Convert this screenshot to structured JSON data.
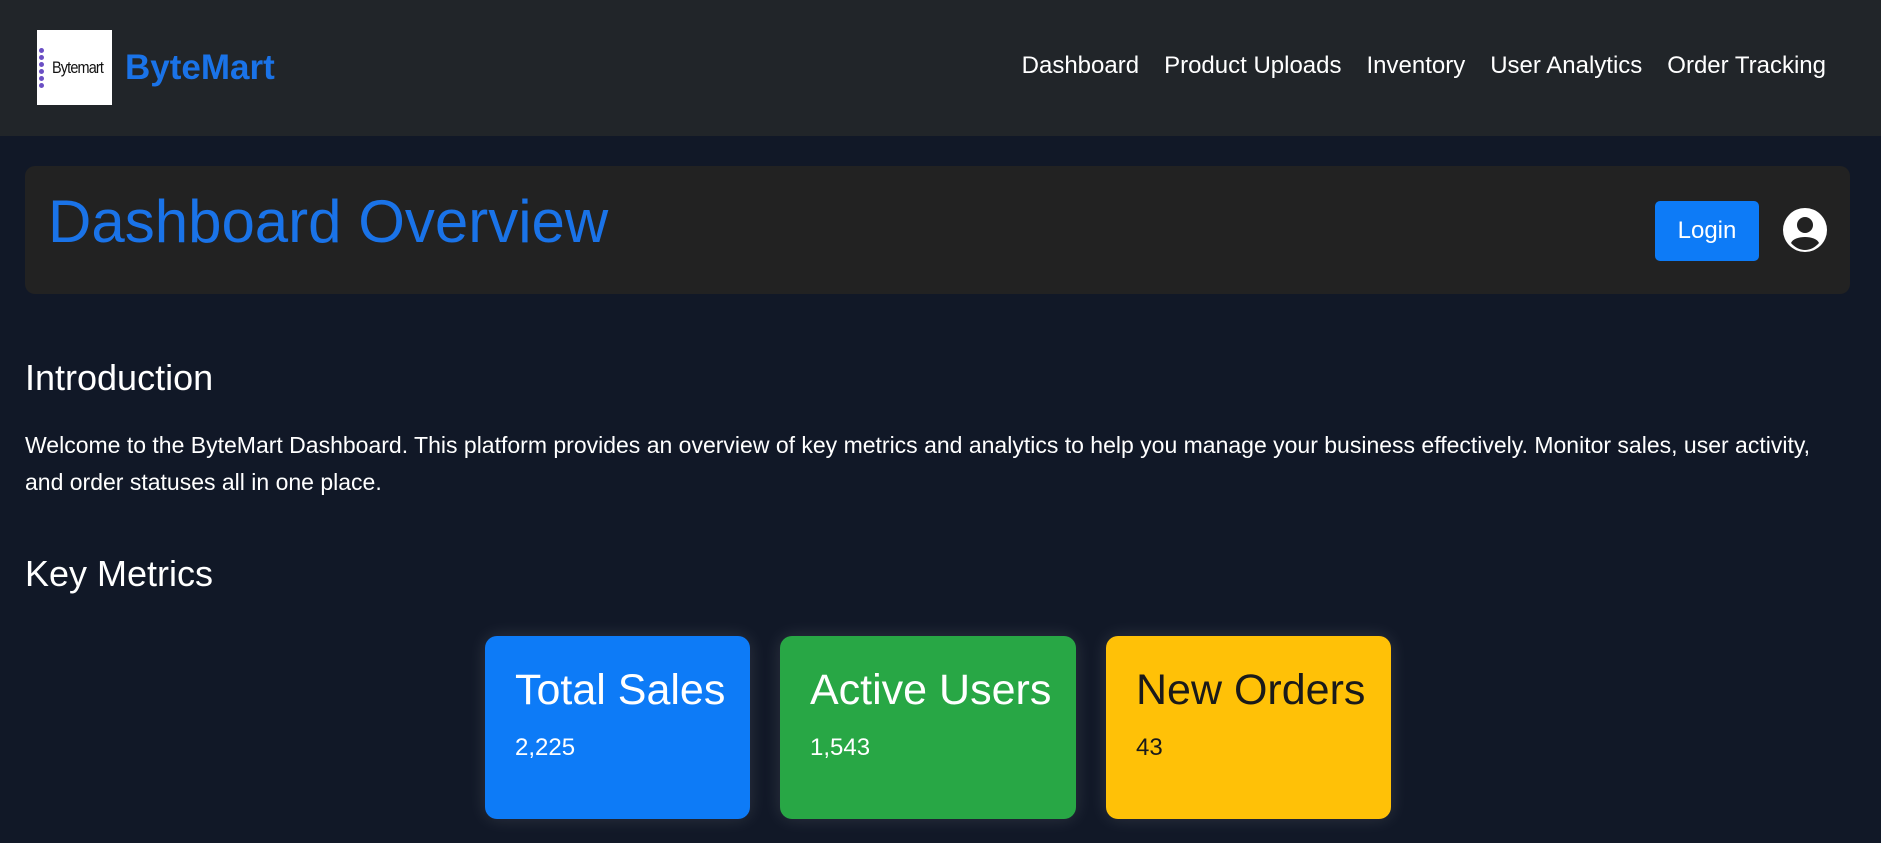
{
  "header": {
    "logo_text": "Bytemart",
    "brand_name": "ByteMart",
    "nav": [
      "Dashboard",
      "Product Uploads",
      "Inventory",
      "User Analytics",
      "Order Tracking"
    ]
  },
  "hero": {
    "title": "Dashboard Overview",
    "login_label": "Login",
    "user_icon": "user-circle-icon"
  },
  "intro": {
    "heading": "Introduction",
    "text": "Welcome to the ByteMart Dashboard. This platform provides an overview of key metrics and analytics to help you manage your business effectively. Monitor sales, user activity, and order statuses all in one place."
  },
  "metrics": {
    "heading": "Key Metrics",
    "cards": [
      {
        "title": "Total Sales",
        "value": "2,225",
        "color": "#0d7bf7"
      },
      {
        "title": "Active Users",
        "value": "1,543",
        "color": "#28a745"
      },
      {
        "title": "New Orders",
        "value": "43",
        "color": "#ffc107"
      }
    ]
  },
  "colors": {
    "brand": "#1a73e8",
    "navbar_bg": "#212529",
    "page_bg": "#111827",
    "hero_bg": "#222222"
  }
}
